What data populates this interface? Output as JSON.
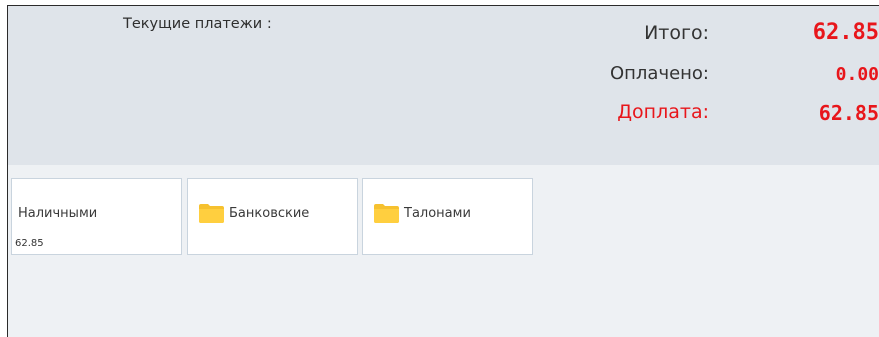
{
  "summary": {
    "current_payments_label": "Текущие платежи :",
    "total_label": "Итого:",
    "total_value": "62.85",
    "paid_label": "Оплачено:",
    "paid_value": "0.00",
    "due_label": "Доплата:",
    "due_value": "62.85",
    "colors": {
      "accent_red": "#e8161b",
      "text_dark": "#333333",
      "summary_bg": "#dfe4ea"
    }
  },
  "payment_methods": [
    {
      "label": "Наличными",
      "amount": "62.85",
      "icon": null
    },
    {
      "label": "Банковские",
      "amount": "",
      "icon": "folder-icon"
    },
    {
      "label": "Талонами",
      "amount": "",
      "icon": "folder-icon"
    }
  ],
  "folder_icon_color": "#f6c12f"
}
